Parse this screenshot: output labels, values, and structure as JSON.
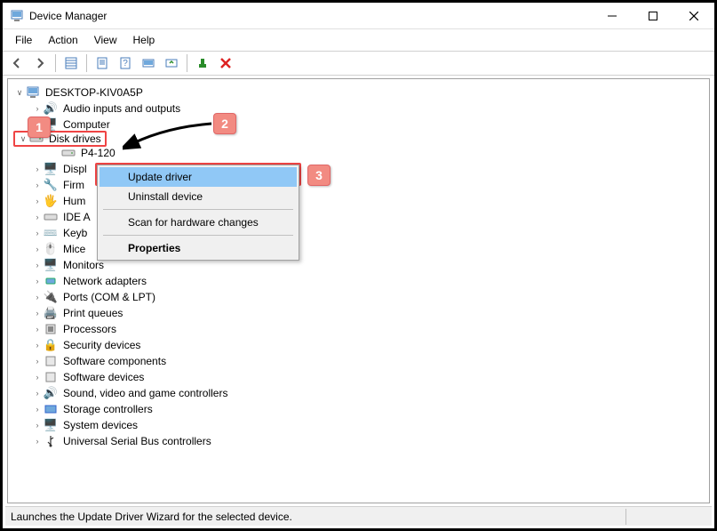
{
  "window": {
    "title": "Device Manager"
  },
  "menu": {
    "file": "File",
    "action": "Action",
    "view": "View",
    "help": "Help"
  },
  "tree": {
    "root": "DESKTOP-KIV0A5P",
    "nodes": {
      "audio": "Audio inputs and outputs",
      "computer": "Computer",
      "diskdrives": "Disk drives",
      "p4120": "P4-120",
      "display": "Displ",
      "firmware": "Firm",
      "hid": "Hum",
      "ide": "IDE A",
      "keyboards": "Keyb",
      "mice": "Mice",
      "monitors": "Monitors",
      "network": "Network adapters",
      "ports": "Ports (COM & LPT)",
      "printqueues": "Print queues",
      "processors": "Processors",
      "security": "Security devices",
      "swcomp": "Software components",
      "swdev": "Software devices",
      "sound": "Sound, video and game controllers",
      "storage": "Storage controllers",
      "system": "System devices",
      "usb": "Universal Serial Bus controllers"
    }
  },
  "context_menu": {
    "update": "Update driver",
    "uninstall": "Uninstall device",
    "scan": "Scan for hardware changes",
    "properties": "Properties"
  },
  "status": {
    "text": "Launches the Update Driver Wizard for the selected device."
  },
  "annotations": {
    "badge1": "1",
    "badge2": "2",
    "badge3": "3"
  }
}
